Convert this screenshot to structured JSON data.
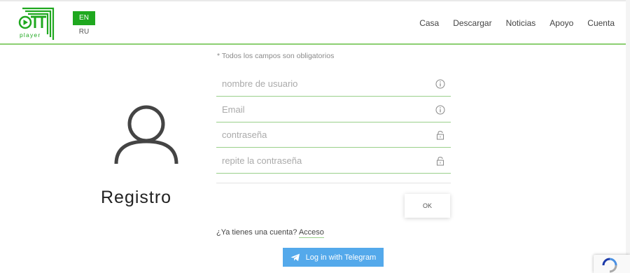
{
  "header": {
    "logo_text": "player",
    "languages": {
      "active": "EN",
      "other": "RU"
    },
    "nav": [
      "Casa",
      "Descargar",
      "Noticias",
      "Apoyo",
      "Cuenta"
    ]
  },
  "form": {
    "required_note": "* Todos los campos son obligatorios",
    "fields": [
      {
        "placeholder": "nombre de usuario",
        "icon": "info-icon"
      },
      {
        "placeholder": "Email",
        "icon": "info-icon"
      },
      {
        "placeholder": "contraseña",
        "icon": "lock-icon"
      },
      {
        "placeholder": "repite la contraseña",
        "icon": "lock-icon"
      }
    ],
    "submit_label": "OK",
    "have_account": "¿Ya tienes una cuenta?",
    "login_link": "Acceso",
    "telegram_label": "Log in with Telegram"
  },
  "title": "Registro",
  "colors": {
    "brand_green": "#1fa81f",
    "rule_green": "#8ccf72",
    "telegram_blue": "#54a9eb"
  }
}
